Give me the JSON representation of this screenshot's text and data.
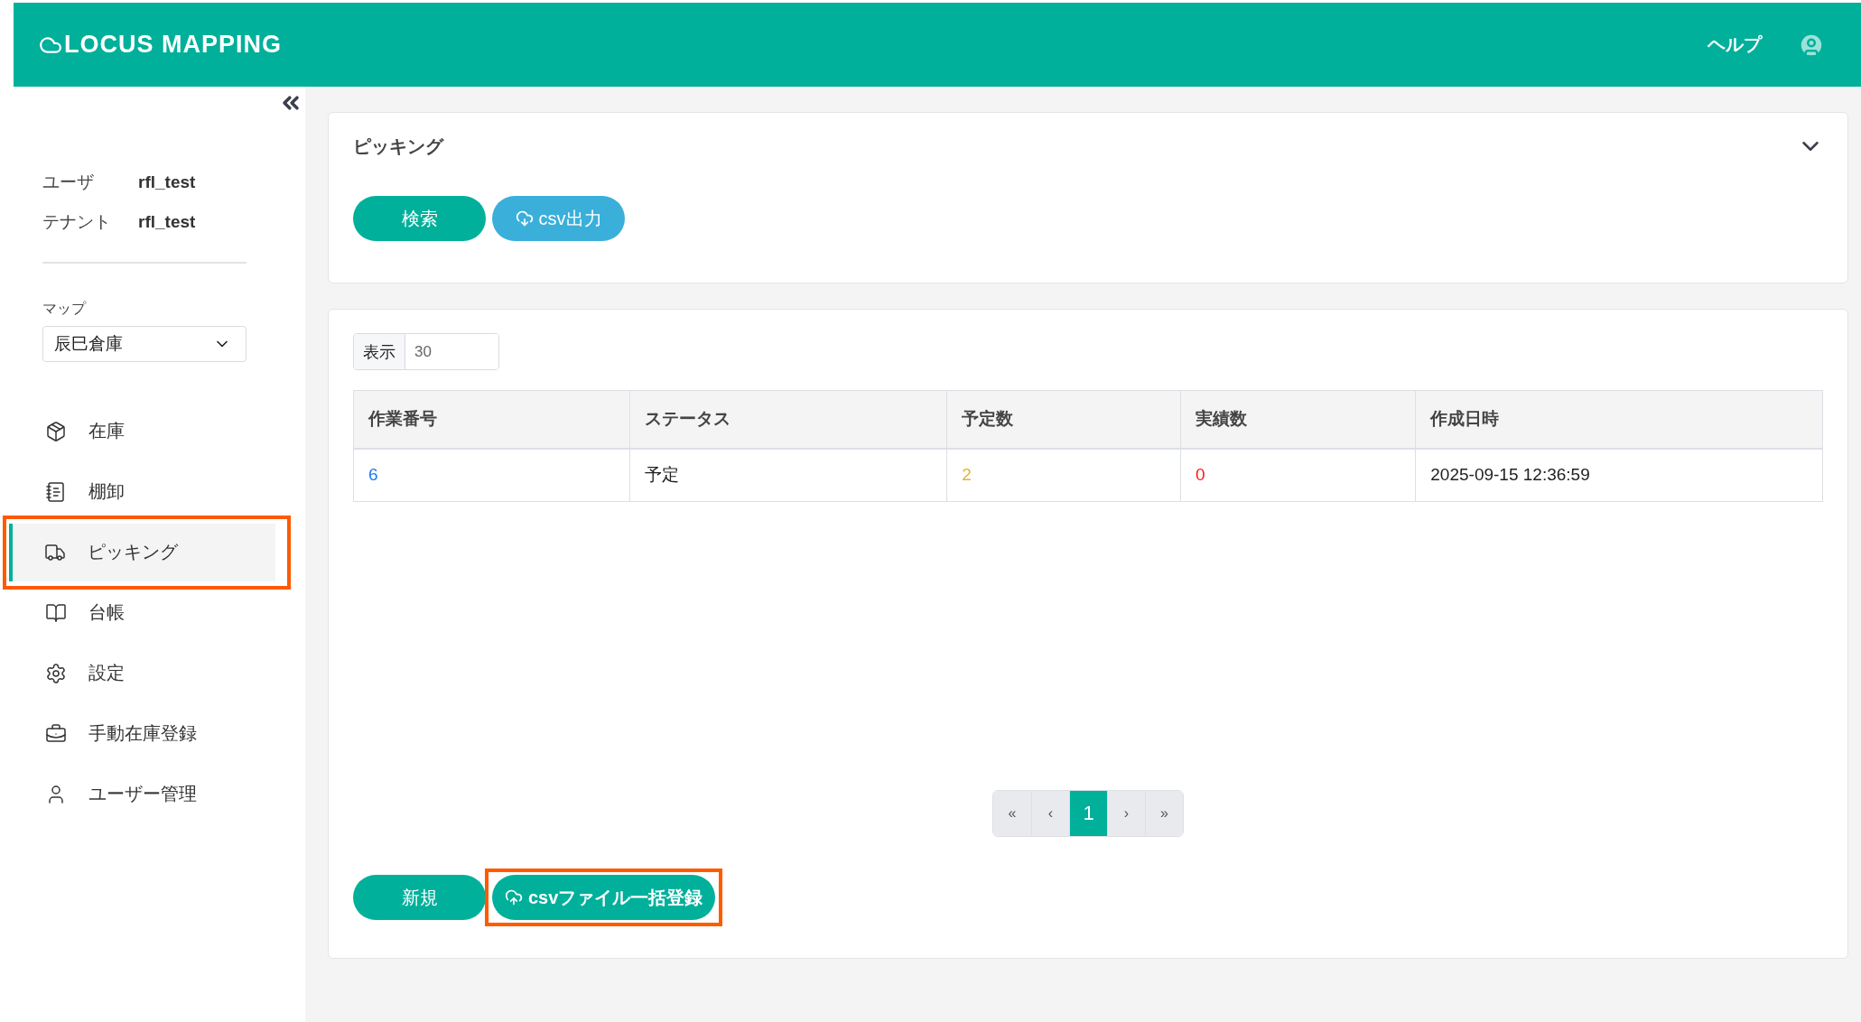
{
  "header": {
    "logo": "LOCUS MAPPING",
    "help": "ヘルプ"
  },
  "sidebar": {
    "user_info": [
      {
        "label": "ユーザ",
        "value": "rfl_test"
      },
      {
        "label": "テナント",
        "value": "rfl_test"
      }
    ],
    "map": {
      "label": "マップ",
      "value": "辰巳倉庫"
    },
    "items": [
      {
        "label": "在庫",
        "selected": false,
        "highlighted": false
      },
      {
        "label": "棚卸",
        "selected": false,
        "highlighted": false
      },
      {
        "label": "ピッキング",
        "selected": true,
        "highlighted": true
      },
      {
        "label": "台帳",
        "selected": false,
        "highlighted": false
      },
      {
        "label": "設定",
        "selected": false,
        "highlighted": false
      },
      {
        "label": "手動在庫登録",
        "selected": false,
        "highlighted": false
      },
      {
        "label": "ユーザー管理",
        "selected": false,
        "highlighted": false
      }
    ]
  },
  "search_panel": {
    "title": "ピッキング",
    "expanded": true,
    "buttons": [
      {
        "label": "検索",
        "kind": "search"
      },
      {
        "label": "csv出力",
        "kind": "download"
      }
    ]
  },
  "list_panel": {
    "page_size": {
      "label": "表示",
      "value": "30"
    },
    "table": {
      "columns": [
        "作業番号",
        "ステータス",
        "予定数",
        "実績数",
        "作成日時"
      ],
      "rows": [
        [
          {
            "text": "6",
            "kind": "link"
          },
          {
            "text": "予定",
            "kind": "plain"
          },
          {
            "text": "2",
            "kind": "planned"
          },
          {
            "text": "0",
            "kind": "actual"
          },
          {
            "text": "2025-09-15 12:36:59",
            "kind": "plain"
          }
        ]
      ]
    },
    "pagination": [
      {
        "label": "«",
        "selected": false
      },
      {
        "label": "‹",
        "selected": false
      },
      {
        "label": "1",
        "selected": true
      },
      {
        "label": "›",
        "selected": false
      },
      {
        "label": "»",
        "selected": false
      }
    ],
    "buttons": [
      {
        "label": "新規",
        "kind": "new",
        "highlighted": false
      },
      {
        "label": "csvファイル一括登録",
        "kind": "upload",
        "highlighted": true
      }
    ]
  }
}
